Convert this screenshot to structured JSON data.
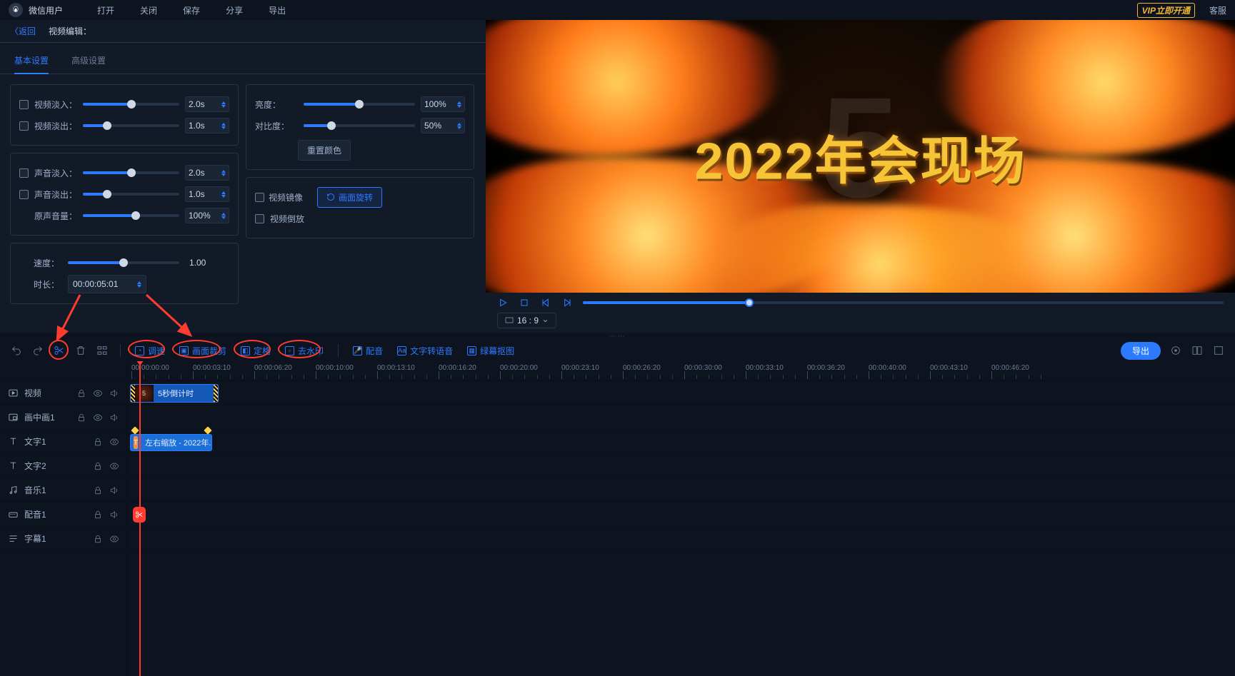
{
  "topbar": {
    "username": "微信用户",
    "menu": [
      "打开",
      "关闭",
      "保存",
      "分享",
      "导出"
    ],
    "vip": "VIP立即开通",
    "service": "客服"
  },
  "header": {
    "back": "〈返回",
    "crumb": "视频编辑："
  },
  "tabs": {
    "basic": "基本设置",
    "advanced": "高级设置"
  },
  "settings": {
    "video_fadein": {
      "label": "视频淡入：",
      "value": "2.0s"
    },
    "video_fadeout": {
      "label": "视频淡出：",
      "value": "1.0s"
    },
    "audio_fadein": {
      "label": "声音淡入：",
      "value": "2.0s"
    },
    "audio_fadeout": {
      "label": "声音淡出：",
      "value": "1.0s"
    },
    "orig_volume": {
      "label": "原声音量：",
      "value": "100%"
    },
    "speed": {
      "label": "速度：",
      "value": "1.00"
    },
    "duration": {
      "label": "时长：",
      "value": "00:00:05:01"
    },
    "brightness": {
      "label": "亮度：",
      "value": "100%"
    },
    "contrast": {
      "label": "对比度：",
      "value": "50%"
    },
    "reset_color": "重置颜色",
    "mirror": "视频镜像",
    "rotate": "画面旋转",
    "reverse": "视频倒放"
  },
  "preview": {
    "overlay_text": "2022年会现场",
    "bg_number": "5",
    "aspect": "16 : 9"
  },
  "toolbar": {
    "speed": "调速",
    "crop": "画面裁剪",
    "freeze": "定格",
    "watermark": "去水印",
    "dub": "配音",
    "tts": "文字转语音",
    "green": "绿幕抠图",
    "export": "导出"
  },
  "ruler_ticks": [
    "00:00:00:00",
    "00:00:03:10",
    "00:00:06:20",
    "00:00:10:00",
    "00:00:13:10",
    "00:00:16:20",
    "00:00:20:00",
    "00:00:23:10",
    "00:00:26:20",
    "00:00:30:00",
    "00:00:33:10",
    "00:00:36:20",
    "00:00:40:00",
    "00:00:43:10",
    "00:00:46:20"
  ],
  "tracks": [
    {
      "label": "视频",
      "icon": "video",
      "ctrls": [
        "lock",
        "eye",
        "speaker"
      ]
    },
    {
      "label": "画中画1",
      "icon": "pip",
      "ctrls": [
        "lock",
        "eye",
        "speaker"
      ]
    },
    {
      "label": "文字1",
      "icon": "text",
      "ctrls": [
        "lock",
        "eye"
      ]
    },
    {
      "label": "文字2",
      "icon": "text",
      "ctrls": [
        "lock",
        "eye"
      ]
    },
    {
      "label": "音乐1",
      "icon": "music",
      "ctrls": [
        "lock",
        "speaker"
      ]
    },
    {
      "label": "配音1",
      "icon": "mic",
      "ctrls": [
        "lock",
        "speaker"
      ]
    },
    {
      "label": "字幕1",
      "icon": "subtitle",
      "ctrls": [
        "lock",
        "eye"
      ]
    }
  ],
  "clips": {
    "video": {
      "label": "5秒倒计时",
      "thumb_num": "5"
    },
    "text": {
      "label": "左右缩放 - 2022年...",
      "icon_txt": "T"
    }
  }
}
